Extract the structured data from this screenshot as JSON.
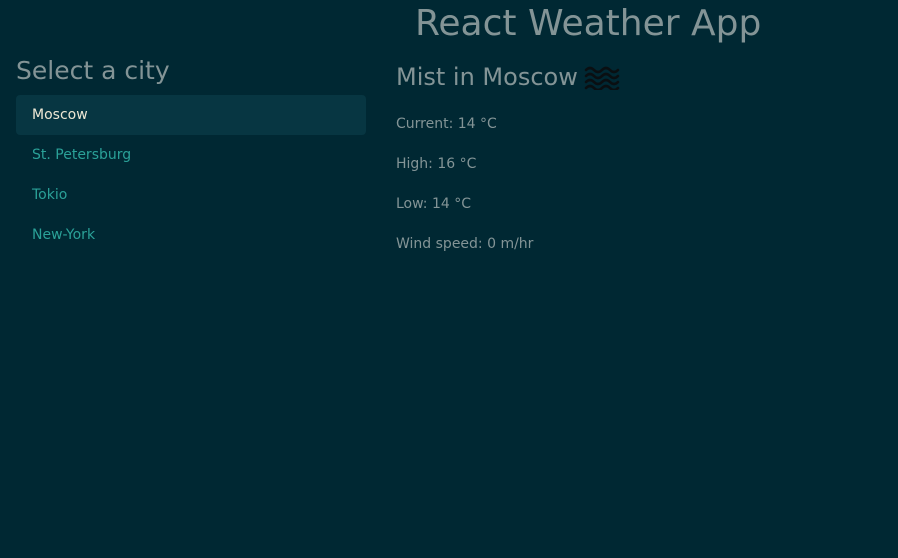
{
  "app": {
    "title": "React Weather App"
  },
  "sidebar": {
    "heading": "Select a city",
    "cities": [
      {
        "label": "Moscow",
        "active": true
      },
      {
        "label": "St. Petersburg",
        "active": false
      },
      {
        "label": "Tokio",
        "active": false
      },
      {
        "label": "New-York",
        "active": false
      }
    ]
  },
  "weather": {
    "heading": "Mist in Moscow",
    "icon": "mist-icon",
    "current": "Current: 14 °C",
    "high": "High: 16 °C",
    "low": "Low: 14 °C",
    "wind": "Wind speed: 0 m/hr"
  },
  "colors": {
    "background": "#002833",
    "accent": "#2aa198",
    "active_bg": "#073642",
    "text": "#839496",
    "active_text": "#eee8d5"
  }
}
